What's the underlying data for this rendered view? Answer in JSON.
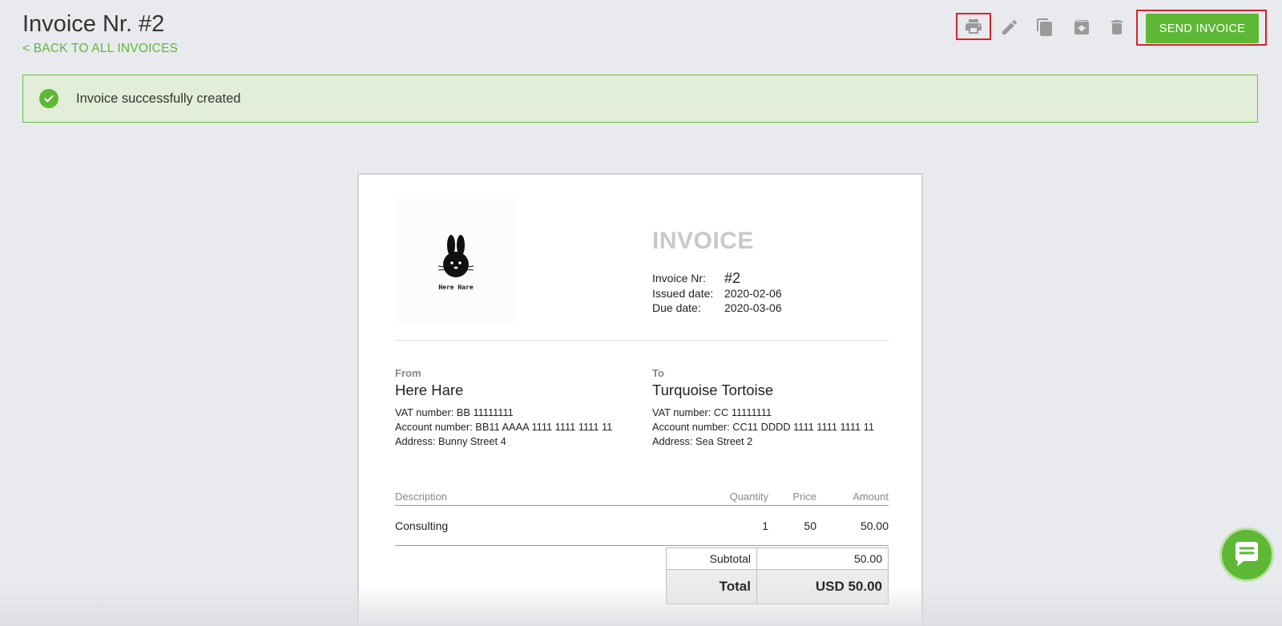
{
  "header": {
    "title": "Invoice Nr. #2",
    "back_link": "< BACK TO ALL INVOICES"
  },
  "toolbar": {
    "icons": [
      "printer-icon",
      "edit-icon",
      "copy-icon",
      "archive-icon",
      "trash-icon"
    ],
    "send_label": "SEND INVOICE",
    "accent": "#5eb836"
  },
  "alert": {
    "message": "Invoice successfully created",
    "icon": "check-circle-icon"
  },
  "invoice": {
    "heading": "INVOICE",
    "logo_text": "Here Hare",
    "meta": [
      {
        "label": "Invoice Nr:",
        "value": "#2"
      },
      {
        "label": "Issued date:",
        "value": "2020-02-06"
      },
      {
        "label": "Due date:",
        "value": "2020-03-06"
      }
    ],
    "from": {
      "label": "From",
      "name": "Here Hare",
      "vat": "VAT number: BB 11111111",
      "account": "Account number: BB11 AAAA 1111 1111 1111 11",
      "address": "Address: Bunny Street 4"
    },
    "to": {
      "label": "To",
      "name": "Turquoise Tortoise",
      "vat": "VAT number: CC 11111111",
      "account": "Account number: CC11 DDDD 1111 1111 1111 11",
      "address": "Address: Sea Street 2"
    },
    "columns": {
      "description": "Description",
      "quantity": "Quantity",
      "price": "Price",
      "amount": "Amount"
    },
    "items": [
      {
        "description": "Consulting",
        "quantity": "1",
        "price": "50",
        "amount": "50.00"
      }
    ],
    "subtotal_label": "Subtotal",
    "subtotal_value": "50.00",
    "total_label": "Total",
    "total_value": "USD 50.00"
  }
}
